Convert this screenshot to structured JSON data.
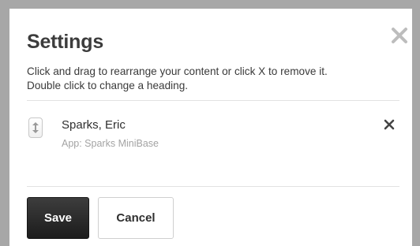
{
  "dialog": {
    "title": "Settings",
    "description_line1": "Click and drag to rearrange your content or click X to remove it.",
    "description_line2": "Double click to change a heading."
  },
  "items": [
    {
      "name": "Sparks, Eric",
      "app": "App: Sparks MiniBase"
    }
  ],
  "buttons": {
    "save": "Save",
    "cancel": "Cancel"
  },
  "icons": {
    "close": "close-icon",
    "drag": "drag-handle-icon",
    "remove": "remove-icon"
  },
  "colors": {
    "frame": "#a7a7a7",
    "primary_button": "#2a2a2a",
    "secondary_text": "#a3a3a3"
  }
}
